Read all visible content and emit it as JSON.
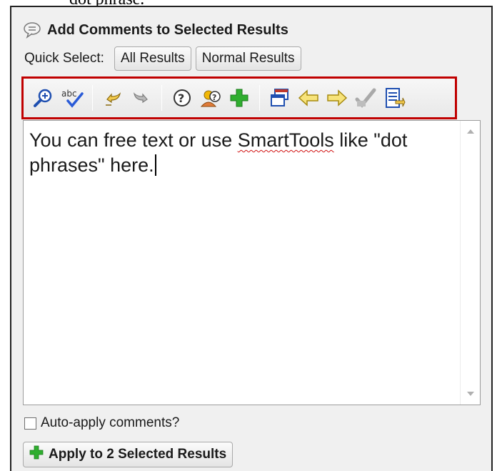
{
  "document_snippet": "dot phrase.",
  "panel": {
    "title": "Add Comments to Selected Results",
    "title_icon": "speech-bubble-icon"
  },
  "quick_select": {
    "label": "Quick Select:",
    "buttons": [
      "All Results",
      "Normal Results"
    ]
  },
  "toolbar": {
    "highlight_color": "#c00000",
    "icons": [
      "zoom-in-icon",
      "spell-check-icon",
      "undo-icon",
      "redo-icon",
      "help-icon",
      "user-help-icon",
      "add-plus-icon",
      "window-icon",
      "arrow-left-icon",
      "arrow-right-icon",
      "approve-check-icon",
      "document-list-icon"
    ]
  },
  "editor": {
    "text_before": "You can free text or use ",
    "misspelled_word": "SmartTools",
    "text_after": " like \"dot phrases\" here."
  },
  "auto_apply": {
    "label": "Auto-apply comments?",
    "checked": false
  },
  "apply_button": {
    "label": "Apply to 2 Selected Results",
    "icon": "add-plus-icon",
    "icon_color": "#2fae2f"
  }
}
